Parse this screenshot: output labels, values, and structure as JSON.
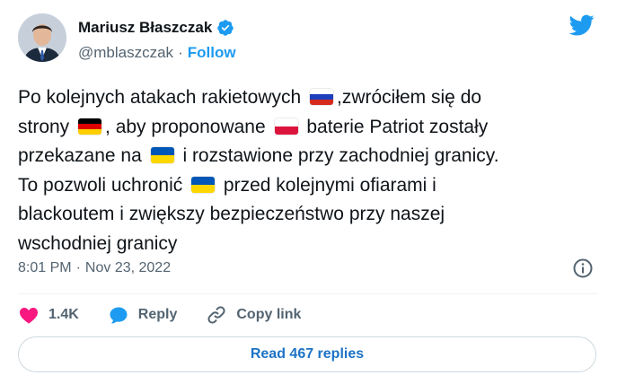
{
  "author": {
    "name": "Mariusz Błaszczak",
    "handle": "@mblaszczak",
    "separator": "·",
    "follow_label": "Follow"
  },
  "icons": {
    "verified": "verified-badge-icon",
    "logo": "twitter-bird-icon",
    "info": "info-icon",
    "like": "heart-icon",
    "reply": "reply-bubble-icon",
    "copy": "link-icon"
  },
  "tweet": {
    "lines": [
      [
        "Po kolejnych atakach rakietowych ",
        {
          "flag": "ru"
        },
        ",zwróciłem się do"
      ],
      [
        "strony ",
        {
          "flag": "de"
        },
        ", aby proponowane ",
        {
          "flag": "pl"
        },
        " baterie Patriot zostały"
      ],
      [
        "przekazane na ",
        {
          "flag": "ua"
        },
        " i rozstawione przy zachodniej granicy."
      ],
      [
        "To pozwoli uchronić ",
        {
          "flag": "ua"
        },
        " przed kolejnymi ofiarami i"
      ],
      [
        "blackoutem i zwiększy bezpieczeństwo przy naszej"
      ],
      [
        "wschodniej granicy"
      ]
    ],
    "flags": {
      "ru": [
        "#ffffff",
        "#1c3fbd",
        "#d52b1e"
      ],
      "de": [
        "#000000",
        "#dd0000",
        "#ffce00"
      ],
      "pl": [
        "#ffffff",
        "#dc143c"
      ],
      "ua": [
        "#0057b7",
        "#ffd700"
      ]
    }
  },
  "meta": {
    "time": "8:01 PM",
    "separator": "·",
    "date": "Nov 23, 2022"
  },
  "actions": {
    "like_count": "1.4K",
    "reply_label": "Reply",
    "copy_label": "Copy link"
  },
  "replies_button": "Read 467 replies",
  "colors": {
    "accent": "#1d9bf0",
    "like": "#f91880",
    "text": "#0f1419",
    "muted": "#536471",
    "link_button_text": "#1d73c5"
  }
}
